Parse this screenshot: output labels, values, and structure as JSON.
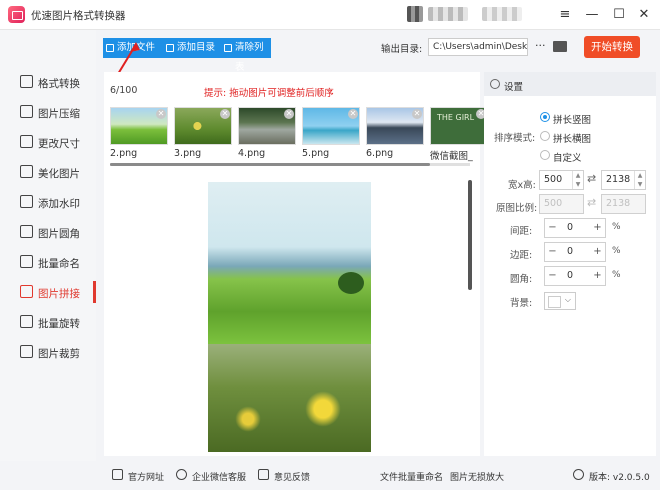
{
  "app": {
    "title": "优速图片格式转换器",
    "window_buttons": [
      "≡",
      "—",
      "☐",
      "✕"
    ]
  },
  "sidebar": {
    "items": [
      {
        "label": "格式转换",
        "icon": "format-convert-icon",
        "active": false
      },
      {
        "label": "图片压缩",
        "icon": "compress-icon",
        "active": false
      },
      {
        "label": "更改尺寸",
        "icon": "resize-icon",
        "active": false
      },
      {
        "label": "美化图片",
        "icon": "beautify-icon",
        "active": false
      },
      {
        "label": "添加水印",
        "icon": "watermark-icon",
        "active": false
      },
      {
        "label": "图片圆角",
        "icon": "round-corner-icon",
        "active": false
      },
      {
        "label": "批量命名",
        "icon": "rename-icon",
        "active": false
      },
      {
        "label": "图片拼接",
        "icon": "stitch-icon",
        "active": true
      },
      {
        "label": "批量旋转",
        "icon": "rotate-icon",
        "active": false
      },
      {
        "label": "图片裁剪",
        "icon": "crop-icon",
        "active": false
      }
    ]
  },
  "toolbar": {
    "add_file": "添加文件",
    "add_dir": "添加目录",
    "clear_list": "清除列表",
    "output_label": "输出目录:",
    "output_path": "C:\\Users\\admin\\Deskto",
    "more": "···",
    "start": "开始转换"
  },
  "list": {
    "count": "6/100",
    "hint": "提示: 拖动图片可调整前后顺序",
    "files": [
      "2.png",
      "3.png",
      "4.png",
      "5.png",
      "6.png",
      "微信截图_"
    ],
    "thumb_text": "THE GIRL"
  },
  "settings": {
    "header": "设置",
    "order_label": "排序模式:",
    "order_options": [
      "拼长竖图",
      "拼长横图",
      "自定义"
    ],
    "selected_option": "拼长竖图",
    "size_label": "宽x高:",
    "width": "500",
    "height": "2138",
    "ratio_label": "原图比例:",
    "ratio_w": "500",
    "ratio_h": "2138",
    "spacing_label": "间距:",
    "spacing": "0",
    "margin_label": "边距:",
    "margin": "0",
    "radius_label": "圆角:",
    "radius": "0",
    "unit": "%",
    "bg_label": "背景:"
  },
  "footer": {
    "website": "官方网址",
    "wechat": "企业微信客服",
    "feedback": "意见反馈",
    "batch_rename": "文件批量重命名",
    "lossless": "图片无损放大",
    "version": "版本: v2.0.5.0"
  },
  "colors": {
    "accent": "#1e90e6",
    "start": "#f04d27",
    "active": "#e0392f",
    "hint": "#e02020"
  }
}
